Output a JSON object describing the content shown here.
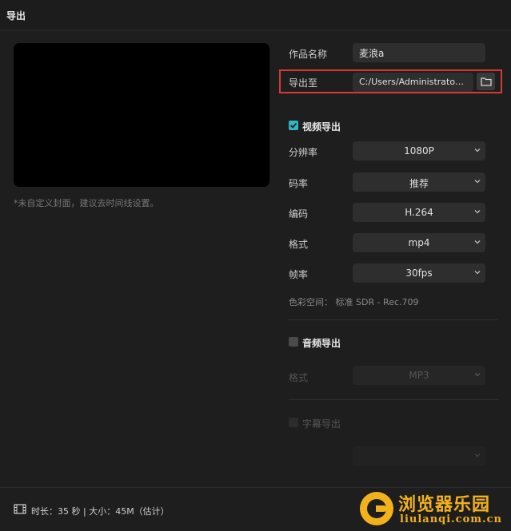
{
  "window": {
    "title": "导出"
  },
  "preview": {
    "cover_hint": "*未自定义封面，建议去时间线设置。"
  },
  "work": {
    "name_label": "作品名称",
    "name_value": "麦浪a"
  },
  "export_path": {
    "label": "导出至",
    "value": "C:/Users/Administrator/..."
  },
  "video": {
    "section_title": "视频导出",
    "checked": true,
    "resolution": {
      "label": "分辨率",
      "value": "1080P"
    },
    "bitrate": {
      "label": "码率",
      "value": "推荐"
    },
    "codec": {
      "label": "编码",
      "value": "H.264"
    },
    "format": {
      "label": "格式",
      "value": "mp4"
    },
    "framerate": {
      "label": "帧率",
      "value": "30fps"
    },
    "color_space": "色彩空间： 标准 SDR - Rec.709"
  },
  "audio": {
    "section_title": "音频导出",
    "checked": false,
    "format": {
      "label": "格式",
      "value": "MP3"
    }
  },
  "subtitle": {
    "section_title": "字幕导出",
    "checked": false
  },
  "footer": {
    "info": "时长：35 秒 | 大小：45M（估计）"
  },
  "watermark": {
    "text_cn": "浏览器乐园",
    "text_en": "liulanqi.com.cn"
  },
  "colors": {
    "accent": "#2fb5c4",
    "highlight": "#d63a35",
    "watermark": "#f3b21b"
  }
}
